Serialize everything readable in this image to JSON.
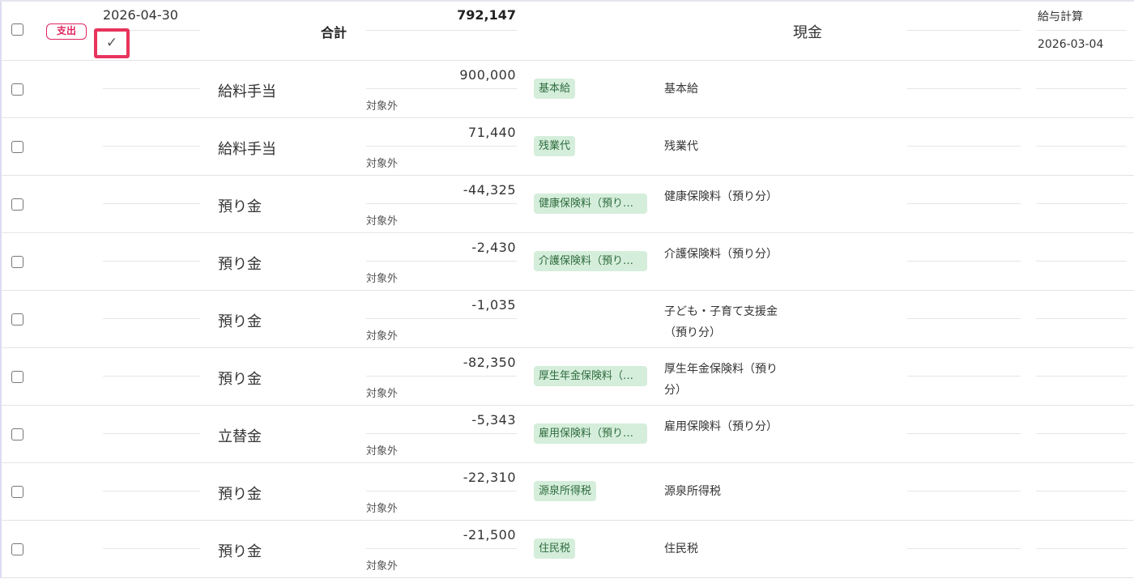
{
  "header": {
    "type_badge": "支出",
    "date": "2026-04-30",
    "check_glyph": "✓",
    "account": "合計",
    "total": "792,147",
    "wallet": "現金",
    "source": "給与計算",
    "source_date": "2026-03-04"
  },
  "rows": [
    {
      "account": "給料手当",
      "amount": "900,000",
      "tax": "対象外",
      "tag": "基本給",
      "memo": "基本給"
    },
    {
      "account": "給料手当",
      "amount": "71,440",
      "tax": "対象外",
      "tag": "残業代",
      "memo": "残業代"
    },
    {
      "account": "預り金",
      "amount": "-44,325",
      "tax": "対象外",
      "tag": "健康保険料（預り分）",
      "memo": "健康保険料（預り分）"
    },
    {
      "account": "預り金",
      "amount": "-2,430",
      "tax": "対象外",
      "tag": "介護保険料（預り分）",
      "memo": "介護保険料（預り分）"
    },
    {
      "account": "預り金",
      "amount": "-1,035",
      "tax": "対象外",
      "tag": "",
      "memo": "子ども・子育て支援金（預り分）"
    },
    {
      "account": "預り金",
      "amount": "-82,350",
      "tax": "対象外",
      "tag": "厚生年金保険料（預り分）",
      "memo": "厚生年金保険料（預り分）"
    },
    {
      "account": "立替金",
      "amount": "-5,343",
      "tax": "対象外",
      "tag": "雇用保険料（預り分）",
      "memo": "雇用保険料（預り分）"
    },
    {
      "account": "預り金",
      "amount": "-22,310",
      "tax": "対象外",
      "tag": "源泉所得税",
      "memo": "源泉所得税"
    },
    {
      "account": "預り金",
      "amount": "-21,500",
      "tax": "対象外",
      "tag": "住民税",
      "memo": "住民税"
    }
  ],
  "colors": {
    "expense_badge": "#e0245e",
    "focus_outline": "#e8335c",
    "tag_background": "#d5eedb",
    "tag_text": "#2e6b3d"
  }
}
